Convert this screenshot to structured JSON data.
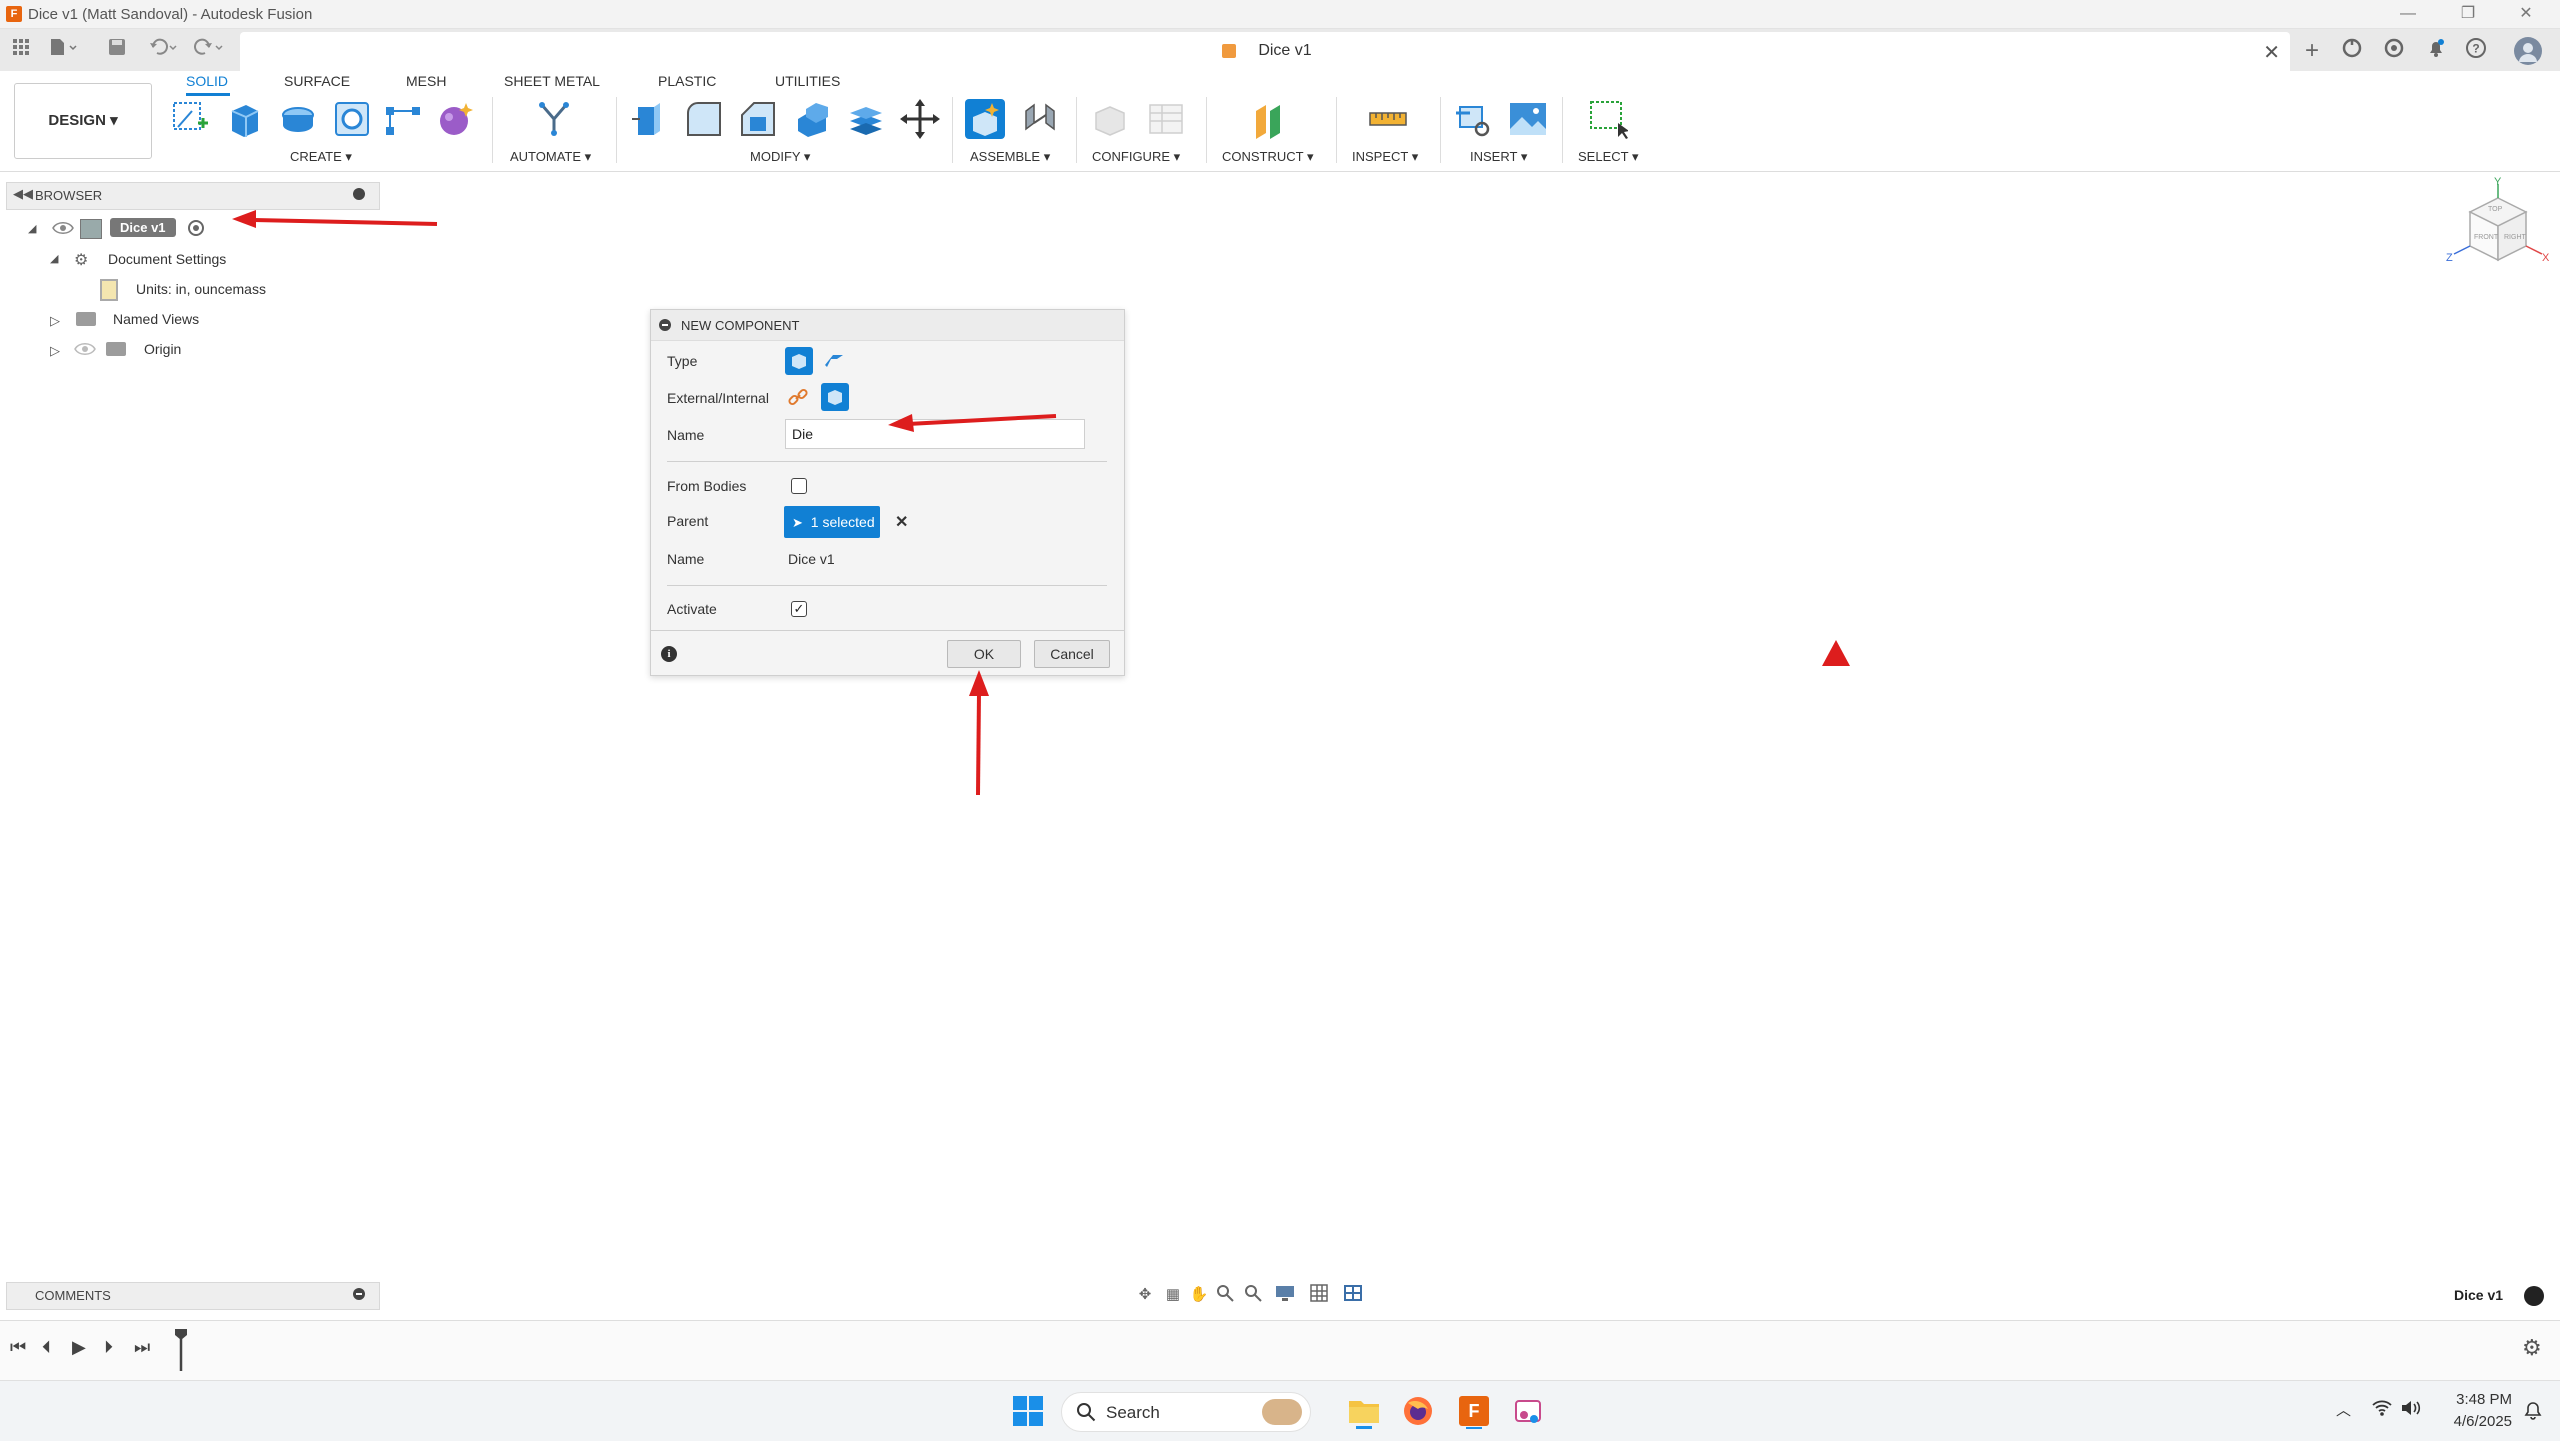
{
  "window": {
    "title": "Dice v1 (Matt Sandoval) - Autodesk Fusion",
    "app_logo": "F",
    "min_glyph": "—",
    "max_glyph": "❐",
    "close_glyph": "✕"
  },
  "document_tab": {
    "title": "Dice v1",
    "close": "✕"
  },
  "ribbon": {
    "workspace": "DESIGN ▾",
    "tabs": [
      "SOLID",
      "SURFACE",
      "MESH",
      "SHEET METAL",
      "PLASTIC",
      "UTILITIES"
    ],
    "groups": {
      "create": "CREATE ▾",
      "automate": "AUTOMATE ▾",
      "modify": "MODIFY ▾",
      "assemble": "ASSEMBLE ▾",
      "configure": "CONFIGURE ▾",
      "construct": "CONSTRUCT ▾",
      "inspect": "INSPECT ▾",
      "insert": "INSERT ▾",
      "select": "SELECT ▾"
    }
  },
  "browser": {
    "header": "BROWSER",
    "root": "Dice v1",
    "items": {
      "document_settings": "Document Settings",
      "units": "Units: in, ouncemass",
      "named_views": "Named Views",
      "origin": "Origin"
    }
  },
  "dialog": {
    "title": "NEW COMPONENT",
    "type_label": "Type",
    "external_label": "External/Internal",
    "name_label": "Name",
    "name_value": "Die",
    "from_bodies_label": "From Bodies",
    "parent_label": "Parent",
    "parent_selected": "1 selected",
    "parent_clear": "✕",
    "name2_label": "Name",
    "name2_value": "Dice v1",
    "activate_label": "Activate",
    "activate_check": "✓",
    "info": "i",
    "ok": "OK",
    "cancel": "Cancel"
  },
  "viewcube": {
    "top": "TOP",
    "front": "FRONT",
    "right": "RIGHT",
    "axis_x": "X",
    "axis_y": "Y",
    "axis_z": "Z"
  },
  "comments": {
    "header": "COMMENTS"
  },
  "status": {
    "doc_name": "Dice v1"
  },
  "taskbar": {
    "search": "Search",
    "time": "3:48 PM",
    "date": "4/6/2025"
  },
  "colors": {
    "accent": "#1180d4",
    "annotation_red": "#dd1d1d",
    "brand_orange": "#e8650f"
  }
}
